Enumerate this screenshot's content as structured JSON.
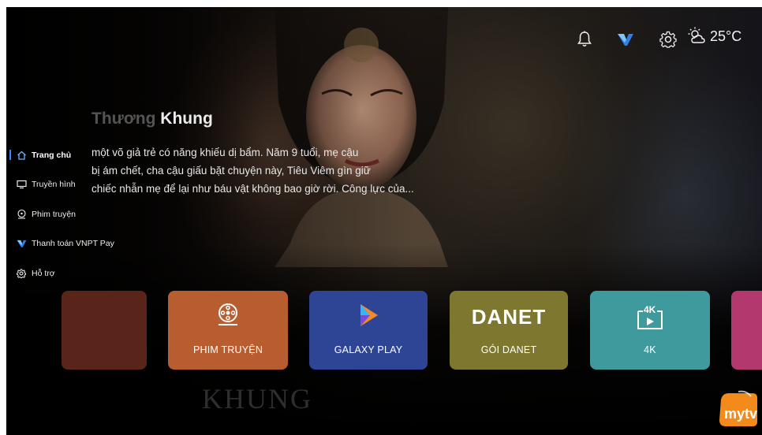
{
  "header": {
    "temperature": "25°C"
  },
  "hero": {
    "title_faded": "Thương",
    "title_main": "Khung",
    "description_lines": [
      "một võ giả trẻ có năng khiếu dị bẩm. Năm 9 tuổi, mẹ cậu",
      "bị ám chết, cha cậu giấu bặt chuyện này, Tiêu Viêm gìn giữ",
      "chiếc nhẫn mẹ để lại như báu vật không bao giờ rời. Công lực của..."
    ],
    "watermark": "KHUNG"
  },
  "sidebar": {
    "items": [
      {
        "label": "Trang chủ",
        "icon": "home-icon",
        "active": true
      },
      {
        "label": "Truyền hình",
        "icon": "tv-icon",
        "active": false
      },
      {
        "label": "Phim truyện",
        "icon": "film-reel-icon",
        "active": false
      },
      {
        "label": "Thanh toán VNPT Pay",
        "icon": "vnpt-pay-icon",
        "active": false
      },
      {
        "label": "Hỗ trợ",
        "icon": "support-gear-icon",
        "active": false
      }
    ]
  },
  "tiles": [
    {
      "label": "",
      "icon": "partial-tile"
    },
    {
      "label": "PHIM TRUYỆN",
      "icon": "film-reel-icon"
    },
    {
      "label": "GALAXY PLAY",
      "icon": "galaxy-play-logo"
    },
    {
      "label": "GÓI DANET",
      "logo_text": "DANET",
      "icon": "danet-logo"
    },
    {
      "label": "4K",
      "badge": "4K",
      "icon": "4k-play-icon"
    },
    {
      "label": "",
      "icon": "partial-tile"
    }
  ],
  "brand": {
    "logo": "mytv-logo",
    "logo_text": "mytv"
  },
  "colors": {
    "accent": "#2e8bff",
    "tile_phim": "#b85d2f",
    "tile_galaxy": "#2e4494",
    "tile_danet": "#7d7730",
    "tile_4k": "#3f9a9e",
    "tile_next": "#b2386e",
    "brand_orange": "#f28a1c"
  }
}
